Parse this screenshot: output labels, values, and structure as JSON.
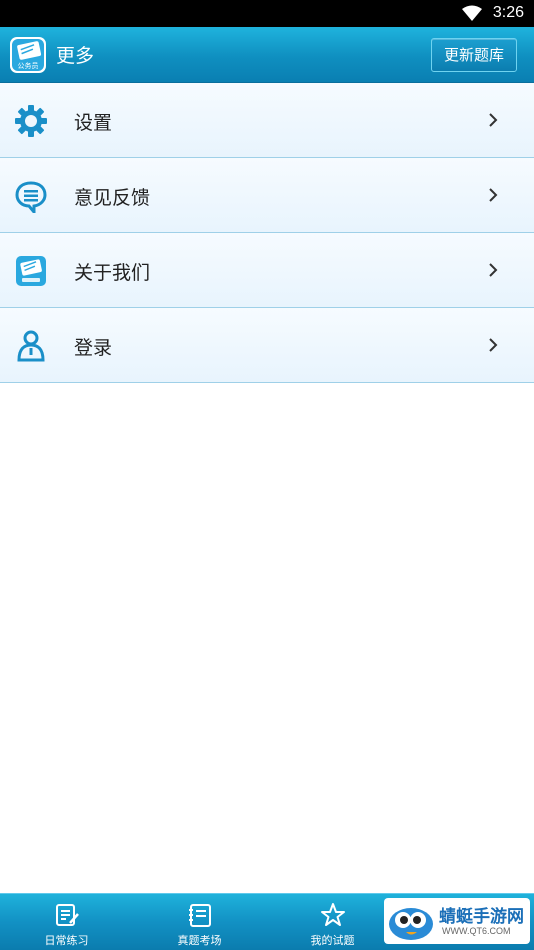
{
  "status_bar": {
    "time": "3:26",
    "wifi_icon": "wifi-icon"
  },
  "header": {
    "logo_text": "公务员",
    "title": "更多",
    "update_button": "更新题库"
  },
  "menu": {
    "items": [
      {
        "label": "设置",
        "icon": "gear-icon"
      },
      {
        "label": "意见反馈",
        "icon": "chat-bubble-icon"
      },
      {
        "label": "关于我们",
        "icon": "app-logo-icon"
      },
      {
        "label": "登录",
        "icon": "user-icon"
      }
    ]
  },
  "tabs": [
    {
      "label": "日常练习",
      "icon": "edit-note-icon"
    },
    {
      "label": "真题考场",
      "icon": "notebook-icon"
    },
    {
      "label": "我的试题",
      "icon": "star-icon"
    }
  ],
  "watermark": {
    "text": "蜻蜓手游网",
    "url": "WWW.QT6.COM"
  },
  "colors": {
    "accent": "#1291c4",
    "icon_blue": "#1a8fc8"
  }
}
